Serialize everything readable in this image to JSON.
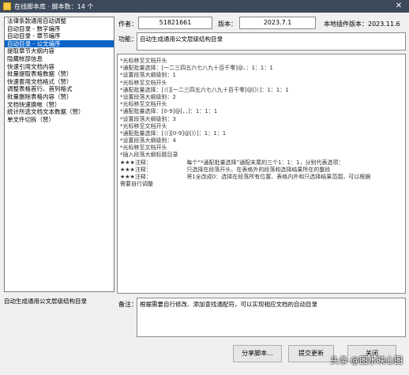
{
  "window": {
    "title": "在线脚本库 · 脚本数：14 个",
    "close": "✕"
  },
  "scripts": [
    "法律条款通用自动调整",
    "自动目录 - 数字编序",
    "自动目录 - 章节编序",
    "自动目录 - 公文编序",
    "提取章节大纲内容",
    "隐藏帐部信息",
    "快速引用文档内容",
    "批量提取表格数据（赞）",
    "快速套用文档格式（赞）",
    "调整表格首行、首列格式",
    "批量删除表格内容（赞）",
    "文档快速换帐（赞）",
    "统计所选文档文本数据（赞）",
    "单文件切拆（赞）"
  ],
  "selected_index": 3,
  "meta": {
    "author_label": "作者：",
    "author": "51821661",
    "version_label": "版本：",
    "version": "2023.7.1",
    "plugin_label": "本地插件版本：2023.11.6"
  },
  "function": {
    "label": "功能：",
    "text": "自动生成通用公文层级结构目录"
  },
  "code_lines": [
    "*光标移至文档开头",
    "*通配批量选择：[一二三四五六七八九十百千零]@、：1：1：1",
    "*设置段落大纲级别：1",
    "*光标移至文档开头",
    "*通配批量选择：[（(][一二三四五六七八九十百千零]@[)）]：1：1：1",
    "*设置段落大纲级别：2",
    "*光标移至文档开头",
    "*通配批量选择：[0-9]@[、．]：1：1：1",
    "*设置段落大纲级别：3",
    "*光标移至文档开头",
    "*通配批量选择：[（(][0-9]@[)）]：1：1：1",
    "*设置段落大纲级别：4",
    "*光标移至文档开头",
    "*插入段落大纲标题目录",
    "★★★注释：                    每个“*通配批量选择”通配末尾的三个1：1：1，分别代表选项：",
    "★★★注释：                    只选择在段落开头、在表格外的段落和选择结果所在的整段",
    "★★★注释：                    将1全改成0：选择在段落所有位置、表格内外和只选择结果范围，可以根据",
    "需要自行调整"
  ],
  "bottom_left": "自动生成通用公文层级结构目录",
  "remark": {
    "label": "备注：",
    "text": "根据需要自行修改、添加查找通配符，可以实现相应文档的自动目录"
  },
  "buttons": {
    "share": "分享脚本...",
    "submit": "提交更新",
    "close": "关闭"
  },
  "watermark": "头条 @图水映心图"
}
